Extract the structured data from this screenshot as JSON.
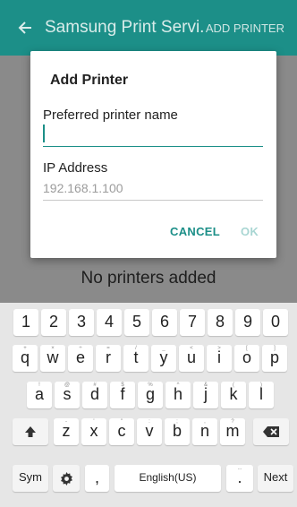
{
  "appbar": {
    "title": "Samsung Print Servi...",
    "action": "ADD PRINTER"
  },
  "content": {
    "empty_message": "No printers added"
  },
  "dialog": {
    "title": "Add Printer",
    "name_label": "Preferred printer name",
    "name_value": "",
    "ip_label": "IP Address",
    "ip_placeholder": "192.168.1.100",
    "cancel": "CANCEL",
    "ok": "OK"
  },
  "keyboard": {
    "numbers": [
      "1",
      "2",
      "3",
      "4",
      "5",
      "6",
      "7",
      "8",
      "9",
      "0"
    ],
    "row1": [
      {
        "k": "q",
        "h": "+"
      },
      {
        "k": "w",
        "h": "×"
      },
      {
        "k": "e",
        "h": "÷"
      },
      {
        "k": "r",
        "h": "="
      },
      {
        "k": "t",
        "h": "/"
      },
      {
        "k": "y",
        "h": "_"
      },
      {
        "k": "u",
        "h": "<"
      },
      {
        "k": "i",
        "h": ">"
      },
      {
        "k": "o",
        "h": "["
      },
      {
        "k": "p",
        "h": "]"
      }
    ],
    "row2": [
      {
        "k": "a",
        "h": "!"
      },
      {
        "k": "s",
        "h": "@"
      },
      {
        "k": "d",
        "h": "#"
      },
      {
        "k": "f",
        "h": "$"
      },
      {
        "k": "g",
        "h": "%"
      },
      {
        "k": "h",
        "h": "^"
      },
      {
        "k": "j",
        "h": "&"
      },
      {
        "k": "k",
        "h": "("
      },
      {
        "k": "l",
        "h": ")"
      }
    ],
    "row3": [
      {
        "k": "z",
        "h": "-"
      },
      {
        "k": "x",
        "h": "'"
      },
      {
        "k": "c",
        "h": "\""
      },
      {
        "k": "v",
        "h": ":"
      },
      {
        "k": "b",
        "h": ";"
      },
      {
        "k": "n",
        "h": ","
      },
      {
        "k": "m",
        "h": "?"
      }
    ],
    "sym": "Sym",
    "comma": ",",
    "space": "English(US)",
    "period": ".",
    "period_hint": "...",
    "next": "Next",
    "icons": {
      "back": "back-arrow-icon",
      "shift": "shift-icon",
      "backspace": "backspace-icon",
      "settings": "gear-icon"
    },
    "colors": {
      "accent": "#1c8f88",
      "keyboard_bg": "#e6e6e6"
    }
  }
}
